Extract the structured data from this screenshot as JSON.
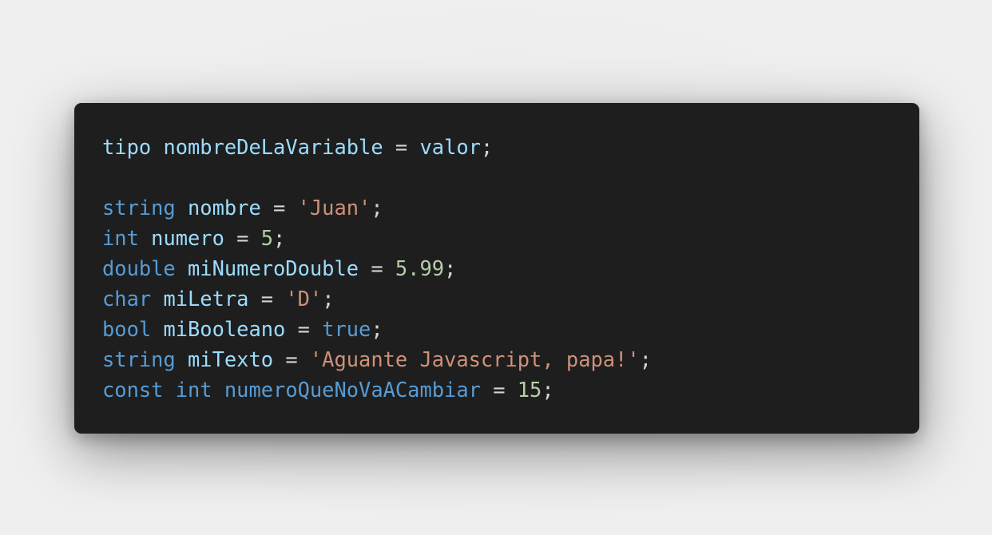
{
  "colors": {
    "background": "#eeeeee",
    "editor_background": "#1e1e1e",
    "keyword": "#569cd6",
    "identifier": "#9cdcfe",
    "string": "#ce9178",
    "number": "#b5cea8",
    "punctuation": "#d4d4d4"
  },
  "code_lines": [
    [
      {
        "t": "id",
        "v": "tipo"
      },
      {
        "t": "op",
        "v": " "
      },
      {
        "t": "id",
        "v": "nombreDeLaVariable"
      },
      {
        "t": "op",
        "v": " = "
      },
      {
        "t": "id",
        "v": "valor"
      },
      {
        "t": "op",
        "v": ";"
      }
    ],
    [],
    [
      {
        "t": "kw",
        "v": "string"
      },
      {
        "t": "op",
        "v": " "
      },
      {
        "t": "id",
        "v": "nombre"
      },
      {
        "t": "op",
        "v": " = "
      },
      {
        "t": "str",
        "v": "'Juan'"
      },
      {
        "t": "op",
        "v": ";"
      }
    ],
    [
      {
        "t": "kw",
        "v": "int"
      },
      {
        "t": "op",
        "v": " "
      },
      {
        "t": "id",
        "v": "numero"
      },
      {
        "t": "op",
        "v": " = "
      },
      {
        "t": "num",
        "v": "5"
      },
      {
        "t": "op",
        "v": ";"
      }
    ],
    [
      {
        "t": "kw",
        "v": "double"
      },
      {
        "t": "op",
        "v": " "
      },
      {
        "t": "id",
        "v": "miNumeroDouble"
      },
      {
        "t": "op",
        "v": " = "
      },
      {
        "t": "num",
        "v": "5.99"
      },
      {
        "t": "op",
        "v": ";"
      }
    ],
    [
      {
        "t": "kw",
        "v": "char"
      },
      {
        "t": "op",
        "v": " "
      },
      {
        "t": "id",
        "v": "miLetra"
      },
      {
        "t": "op",
        "v": " = "
      },
      {
        "t": "str",
        "v": "'D'"
      },
      {
        "t": "op",
        "v": ";"
      }
    ],
    [
      {
        "t": "kw",
        "v": "bool"
      },
      {
        "t": "op",
        "v": " "
      },
      {
        "t": "id",
        "v": "miBooleano"
      },
      {
        "t": "op",
        "v": " = "
      },
      {
        "t": "kw",
        "v": "true"
      },
      {
        "t": "op",
        "v": ";"
      }
    ],
    [
      {
        "t": "kw",
        "v": "string"
      },
      {
        "t": "op",
        "v": " "
      },
      {
        "t": "id",
        "v": "miTexto"
      },
      {
        "t": "op",
        "v": " = "
      },
      {
        "t": "str",
        "v": "'Aguante Javascript, papa!'"
      },
      {
        "t": "op",
        "v": ";"
      }
    ],
    [
      {
        "t": "kw",
        "v": "const"
      },
      {
        "t": "op",
        "v": " "
      },
      {
        "t": "kw",
        "v": "int"
      },
      {
        "t": "op",
        "v": " "
      },
      {
        "t": "kw",
        "v": "numeroQueNoVaACambiar"
      },
      {
        "t": "op",
        "v": " = "
      },
      {
        "t": "num",
        "v": "15"
      },
      {
        "t": "op",
        "v": ";"
      }
    ]
  ]
}
